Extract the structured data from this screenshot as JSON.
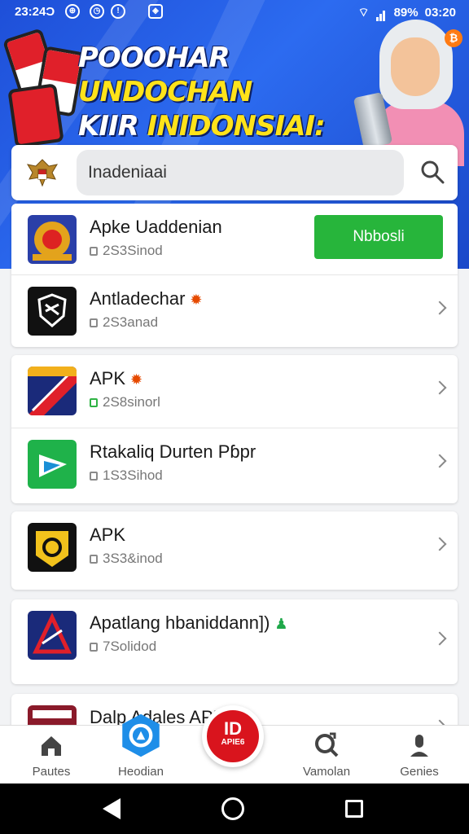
{
  "status_bar": {
    "time_left": "23:24Ɔ",
    "battery": "89%",
    "time_right": "03:20"
  },
  "banner": {
    "title_line1_white": "POOOHAR ",
    "title_line1_yellow": "UNDOCHAN",
    "title_line2_white": "KIIR ",
    "title_line2_yellow": "INIDONSIAI:",
    "badge": "₿"
  },
  "search": {
    "value": "Inadeniaai"
  },
  "apps": [
    {
      "name": "Apke Uaddenian",
      "meta": "2S3Sinod",
      "action_label": "Nbbosli",
      "badge": ""
    },
    {
      "name": "Antladechar",
      "meta": "2S3anad",
      "badge": "✹"
    },
    {
      "name": "APK",
      "meta": "2S8sinorl",
      "badge": "✹"
    },
    {
      "name": "Rtakaliq Durten Pɓpr",
      "meta": "1S3Sihod",
      "badge": ""
    },
    {
      "name": "APK",
      "meta": "3S3&inod",
      "badge": ""
    },
    {
      "name": "Apatlang hbaniddann])",
      "meta": "7Solidod",
      "badge": "♟"
    },
    {
      "name": "Dalp  Adales  APK",
      "meta": "",
      "badge": ""
    }
  ],
  "bottom_nav": {
    "items": [
      {
        "label": "Pautes"
      },
      {
        "label": "Heodian"
      },
      {
        "label": "Vamolan"
      },
      {
        "label": "Genies"
      }
    ],
    "fab_big": "ID",
    "fab_small": "APIE6"
  },
  "colors": {
    "banner_blue": "#2c6bf0",
    "accent_green": "#27b53b",
    "fab_red": "#d9141d"
  }
}
